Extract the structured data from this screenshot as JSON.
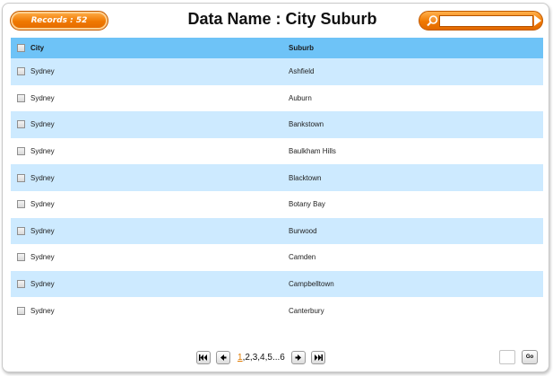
{
  "header": {
    "records_label": "Records : 52",
    "title": "Data Name : City Suburb",
    "search": {
      "value": "",
      "placeholder": ""
    }
  },
  "table": {
    "columns": [
      "City",
      "Suburb"
    ],
    "rows": [
      {
        "city": "Sydney",
        "suburb": "Ashfield"
      },
      {
        "city": "Sydney",
        "suburb": "Auburn"
      },
      {
        "city": "Sydney",
        "suburb": "Bankstown"
      },
      {
        "city": "Sydney",
        "suburb": "Baulkham Hills"
      },
      {
        "city": "Sydney",
        "suburb": "Blacktown"
      },
      {
        "city": "Sydney",
        "suburb": "Botany Bay"
      },
      {
        "city": "Sydney",
        "suburb": "Burwood"
      },
      {
        "city": "Sydney",
        "suburb": "Camden"
      },
      {
        "city": "Sydney",
        "suburb": "Campbelltown"
      },
      {
        "city": "Sydney",
        "suburb": "Canterbury"
      }
    ]
  },
  "pager": {
    "pages": [
      "1",
      "2",
      "3",
      "4",
      "5",
      "6"
    ],
    "current_page": "1",
    "ellipsis": "...",
    "go_label": "Go",
    "goto_value": ""
  },
  "colors": {
    "accent_orange": "#f07800",
    "header_blue": "#6ec3f7",
    "row_alt": "#cdeaff",
    "current_page": "#e07b00"
  },
  "icons": {
    "first": "first-page-icon",
    "prev": "prev-page-icon",
    "next": "next-page-icon",
    "last": "last-page-icon",
    "search": "search-icon"
  }
}
